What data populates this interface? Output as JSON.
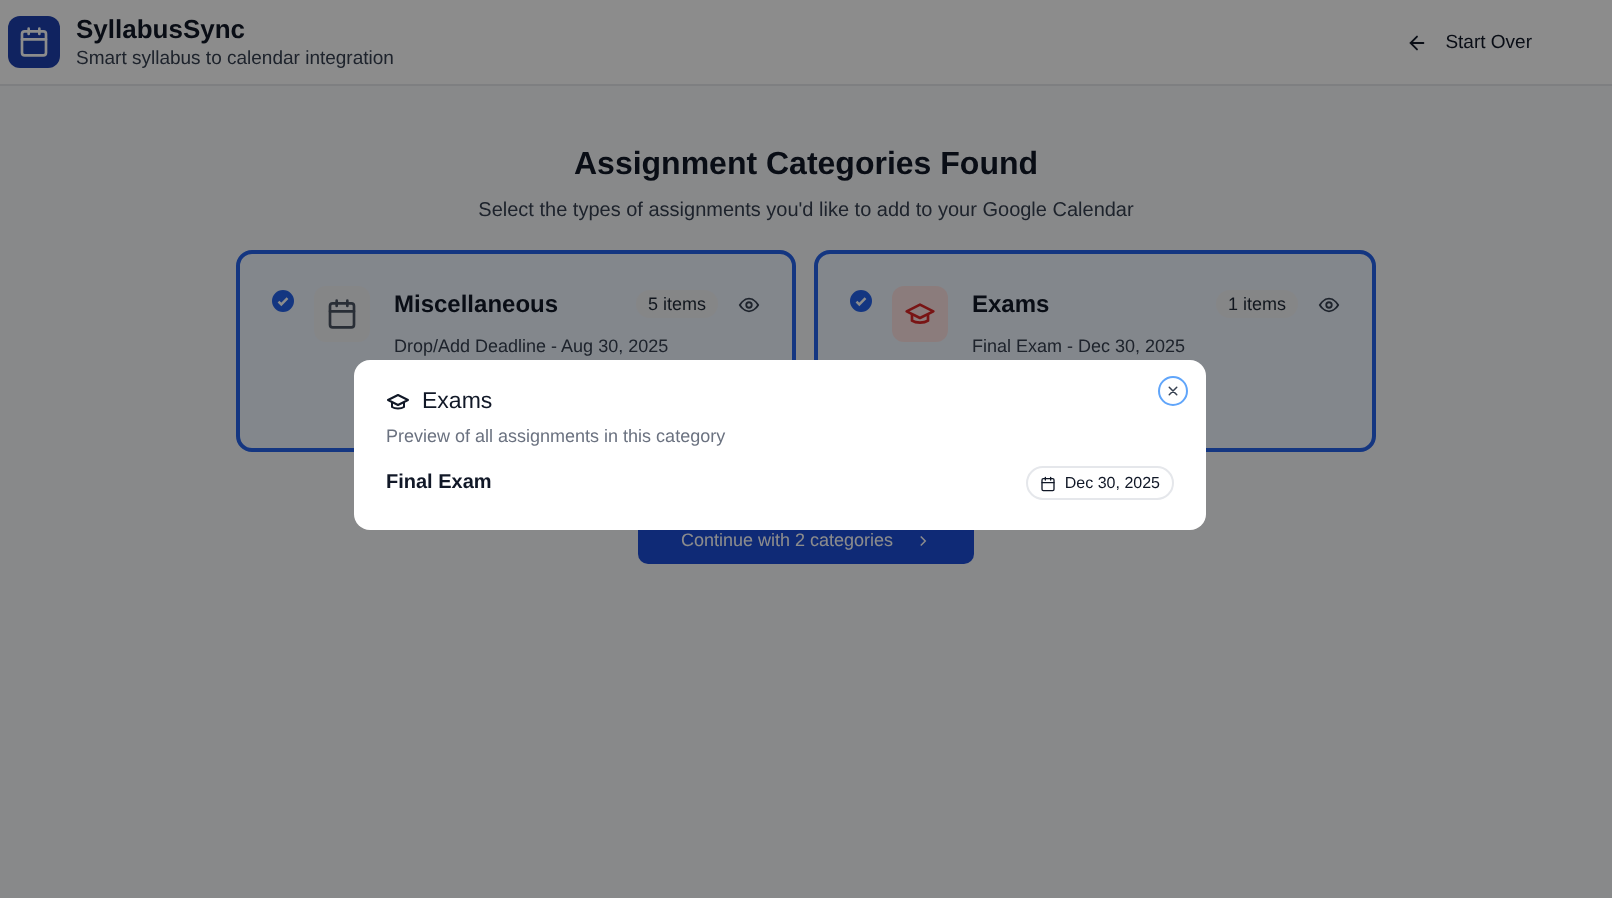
{
  "header": {
    "app_name": "SyllabusSync",
    "tagline": "Smart syllabus to calendar integration",
    "start_over": "Start Over"
  },
  "heading": "Assignment Categories Found",
  "subheading": "Select the types of assignments you'd like to add to your Google Calendar",
  "categories": [
    {
      "name": "Miscellaneous",
      "kind": "calendar",
      "count": "5 items",
      "preview": "Drop/Add Deadline - Aug 30, 2025",
      "checked": true
    },
    {
      "name": "Exams",
      "kind": "exam",
      "count": "1 items",
      "preview": "Final Exam - Dec 30, 2025",
      "checked": true
    }
  ],
  "continue_button": "Continue with 2 categories",
  "modal": {
    "title": "Exams",
    "description": "Preview of all assignments in this category",
    "items": [
      {
        "name": "Final Exam",
        "date": "Dec 30, 2025"
      }
    ]
  }
}
